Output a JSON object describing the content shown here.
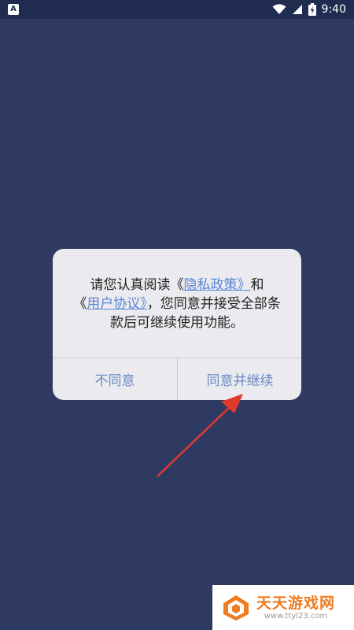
{
  "status_bar": {
    "left_icon": "A",
    "time": "9:40",
    "icons": [
      "wifi-icon",
      "signal-icon",
      "battery-charging-icon"
    ]
  },
  "dialog": {
    "message_part1": "请您认真阅读《",
    "privacy_link": "隐私政策》",
    "message_part2": "和",
    "message_part3": "《",
    "agreement_link": "用户协议》",
    "message_part4": "，您同意并接受全部条款后可继续使用功能。",
    "disagree_label": "不同意",
    "agree_label": "同意并继续"
  },
  "watermark": {
    "title": "天天游戏网",
    "url": "www.ttyl23.com"
  },
  "colors": {
    "background": "#2e3a62",
    "dialog": "#ebebef",
    "link": "#5b86d6",
    "button_text": "#6b8ac4",
    "annotation_arrow": "#e03a2e",
    "watermark_orange": "#f07c22"
  }
}
